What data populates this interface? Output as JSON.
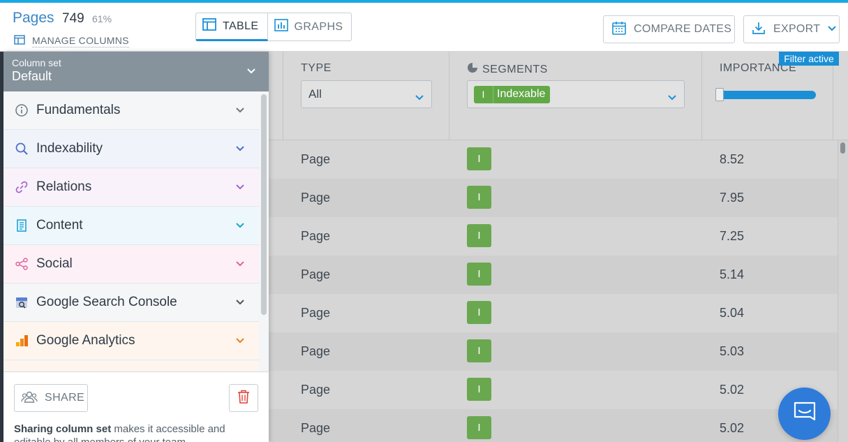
{
  "header": {
    "title": "Pages",
    "count": "749",
    "percent": "61%",
    "manage_columns": "MANAGE COLUMNS",
    "tabs": [
      {
        "label": "TABLE"
      },
      {
        "label": "GRAPHS"
      }
    ],
    "compare_dates": "COMPARE DATES",
    "export": "EXPORT"
  },
  "panel": {
    "column_set_label": "Column set",
    "column_set_value": "Default",
    "categories": [
      {
        "label": "Fundamentals",
        "icon": "info-icon",
        "bg": "#f4f6f8",
        "color": "#6b7780"
      },
      {
        "label": "Indexability",
        "icon": "search-icon",
        "bg": "#f1f3fb",
        "color": "#4a6fc7"
      },
      {
        "label": "Relations",
        "icon": "link-icon",
        "bg": "#f9f2fb",
        "color": "#a565c9"
      },
      {
        "label": "Content",
        "icon": "document-icon",
        "bg": "#eef8fc",
        "color": "#1aa3d6"
      },
      {
        "label": "Social",
        "icon": "share-icon",
        "bg": "#fdf1f7",
        "color": "#e0639b"
      },
      {
        "label": "Google Search Console",
        "icon": "search-console-icon",
        "bg": "#f4f6f8",
        "color": "#4a5560"
      },
      {
        "label": "Google Analytics",
        "icon": "analytics-icon",
        "bg": "#fdf5ee",
        "color": "#f07b1d"
      }
    ],
    "share_label": "SHARE",
    "share_note_bold": "Sharing column set",
    "share_note": " makes it accessible and editable by all members of your team."
  },
  "table": {
    "filter_active": "Filter active",
    "columns": {
      "type": {
        "title": "TYPE",
        "filter": "All"
      },
      "segments": {
        "title": "SEGMENTS",
        "tag_letter": "I",
        "tag_label": "Indexable"
      },
      "importance": {
        "title": "IMPORTANCE"
      }
    },
    "rows": [
      {
        "type": "Page",
        "segment": "I",
        "importance": "8.52"
      },
      {
        "type": "Page",
        "segment": "I",
        "importance": "7.95"
      },
      {
        "type": "Page",
        "segment": "I",
        "importance": "7.25"
      },
      {
        "type": "Page",
        "segment": "I",
        "importance": "5.14"
      },
      {
        "type": "Page",
        "segment": "I",
        "importance": "5.04"
      },
      {
        "type": "Page",
        "segment": "I",
        "importance": "5.03"
      },
      {
        "type": "Page",
        "segment": "I",
        "importance": "5.02"
      },
      {
        "type": "Page",
        "segment": "I",
        "importance": "5.02"
      }
    ]
  },
  "colors": {
    "accent": "#1b8fd6",
    "segment_green": "#6aa84f",
    "chat": "#2e7bd9"
  }
}
